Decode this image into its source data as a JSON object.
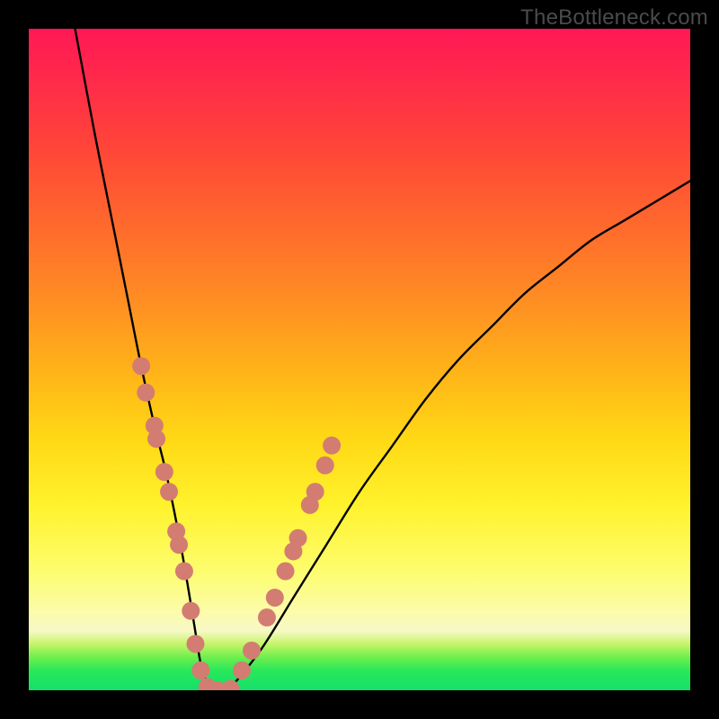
{
  "watermark": "TheBottleneck.com",
  "chart_data": {
    "type": "line",
    "title": "",
    "xlabel": "",
    "ylabel": "",
    "xlim": [
      0,
      100
    ],
    "ylim": [
      0,
      100
    ],
    "grid": false,
    "legend": false,
    "series": [
      {
        "name": "bottleneck-curve",
        "color": "#000000",
        "x": [
          7,
          10,
          13,
          15,
          17,
          19,
          20.5,
          22,
          23.5,
          25,
          26,
          27,
          28,
          30,
          35,
          40,
          45,
          50,
          55,
          60,
          65,
          70,
          75,
          80,
          85,
          90,
          95,
          100
        ],
        "y": [
          100,
          84,
          69,
          59,
          49,
          40,
          34,
          27,
          19,
          10,
          4,
          1,
          0,
          0,
          6,
          14,
          22,
          30,
          37,
          44,
          50,
          55,
          60,
          64,
          68,
          71,
          74,
          77
        ]
      }
    ],
    "highlight_points": {
      "name": "highlight-dots",
      "color": "#d37c72",
      "radius_px": 10,
      "points_xy": [
        [
          17.0,
          49
        ],
        [
          17.7,
          45
        ],
        [
          19.0,
          40
        ],
        [
          19.3,
          38
        ],
        [
          20.5,
          33
        ],
        [
          21.2,
          30
        ],
        [
          22.3,
          24
        ],
        [
          22.7,
          22
        ],
        [
          23.5,
          18
        ],
        [
          24.5,
          12
        ],
        [
          25.2,
          7
        ],
        [
          26.0,
          3
        ],
        [
          27.0,
          0.5
        ],
        [
          28.5,
          0
        ],
        [
          30.5,
          0.2
        ],
        [
          32.2,
          3
        ],
        [
          33.7,
          6
        ],
        [
          36.0,
          11
        ],
        [
          37.2,
          14
        ],
        [
          38.8,
          18
        ],
        [
          40.0,
          21
        ],
        [
          40.7,
          23
        ],
        [
          42.5,
          28
        ],
        [
          43.3,
          30
        ],
        [
          44.8,
          34
        ],
        [
          45.8,
          37
        ]
      ]
    },
    "background_gradient": {
      "orientation": "vertical",
      "stops": [
        {
          "pos": 0.0,
          "color": "#ff1855"
        },
        {
          "pos": 0.4,
          "color": "#ff8a24"
        },
        {
          "pos": 0.72,
          "color": "#fff22c"
        },
        {
          "pos": 0.91,
          "color": "#f7f8c6"
        },
        {
          "pos": 1.0,
          "color": "#14e06a"
        }
      ]
    }
  }
}
